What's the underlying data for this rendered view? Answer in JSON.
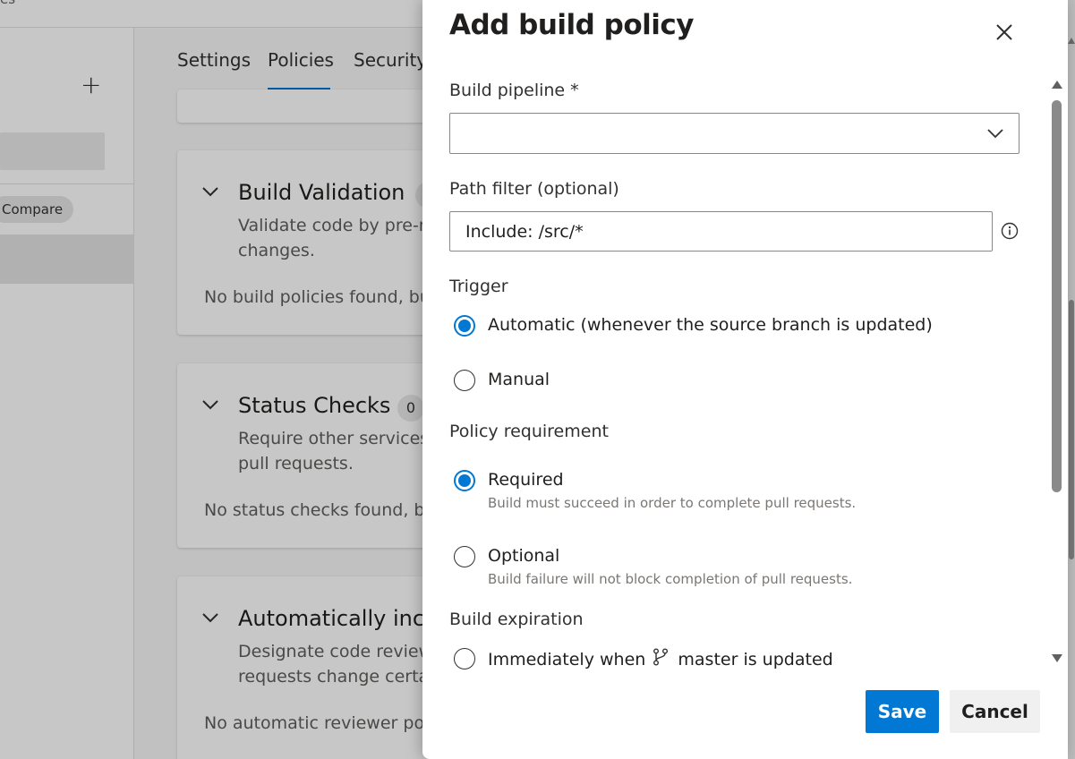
{
  "background": {
    "topbar_fragment": "es",
    "left_panel": {
      "add_glyph": "+",
      "compare_label": "Compare"
    },
    "tabs": [
      {
        "label": "Settings"
      },
      {
        "label": "Policies",
        "active": true
      },
      {
        "label": "Security"
      }
    ],
    "cards": [
      {
        "title": "Build Validation",
        "badge": "",
        "description": "Validate code by pre-merging and building pull request changes.",
        "description_visible": "Validate code by pre-m\nchanges.",
        "empty": "No build policies found, bu"
      },
      {
        "title": "Status Checks",
        "badge": "0",
        "description_visible": "Require other services\npull requests.",
        "empty": "No status checks found, bu"
      },
      {
        "title": "Automatically inclu",
        "badge": "",
        "description_visible": "Designate code review\nrequests change certai",
        "empty": "No automatic reviewer pol"
      }
    ]
  },
  "dialog": {
    "title": "Add build policy",
    "close_icon": "close-icon",
    "build_pipeline": {
      "label": "Build pipeline *",
      "value": ""
    },
    "path_filter": {
      "label": "Path filter (optional)",
      "value": "Include: /src/*"
    },
    "trigger": {
      "label": "Trigger",
      "options": [
        {
          "label": "Automatic (whenever the source branch is updated)",
          "checked": true
        },
        {
          "label": "Manual",
          "checked": false
        }
      ]
    },
    "policy_requirement": {
      "label": "Policy requirement",
      "options": [
        {
          "label": "Required",
          "sub": "Build must succeed in order to complete pull requests.",
          "checked": true
        },
        {
          "label": "Optional",
          "sub": "Build failure will not block completion of pull requests.",
          "checked": false
        }
      ]
    },
    "build_expiration": {
      "label": "Build expiration",
      "option_prefix": "Immediately when",
      "branch_name": "master",
      "option_suffix": "is updated"
    },
    "buttons": {
      "save": "Save",
      "cancel": "Cancel"
    },
    "colors": {
      "accent": "#0078d4",
      "text": "#201f1e",
      "subtext": "#7a7774"
    }
  }
}
